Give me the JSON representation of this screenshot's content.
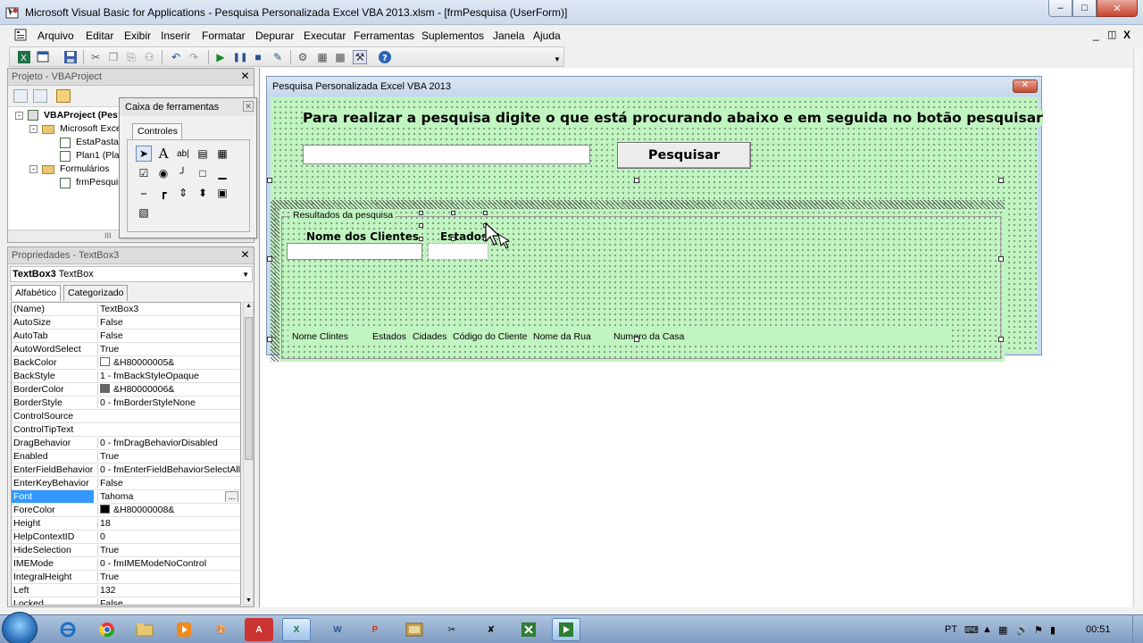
{
  "window": {
    "title": "Microsoft Visual Basic for Applications - Pesquisa Personalizada Excel VBA 2013.xlsm - [frmPesquisa (UserForm)]",
    "min_label": "–",
    "max_label": "□",
    "close_label": "✕"
  },
  "menu": {
    "items": [
      "Arquivo",
      "Editar",
      "Exibir",
      "Inserir",
      "Formatar",
      "Depurar",
      "Executar",
      "Ferramentas",
      "Suplementos",
      "Janela",
      "Ajuda"
    ],
    "controls": [
      "_",
      "&#8862;",
      "X"
    ]
  },
  "project": {
    "title": "Projeto - VBAProject",
    "close": "✕",
    "root": "VBAProject (Pes",
    "excel_folder": "Microsoft Exce",
    "sheet1": "EstaPasta_",
    "sheet2": "Plan1 (Plan",
    "forms_folder": "Formulários",
    "form": "frmPesquis",
    "scroll_label": "III"
  },
  "toolbox": {
    "title": "Caixa de ferramentas",
    "close": "✕",
    "tab": "Controles"
  },
  "properties": {
    "title": "Propriedades - TextBox3",
    "close": "✕",
    "object_name": "TextBox3",
    "object_type": "TextBox",
    "tab_alpha": "Alfabético",
    "tab_cat": "Categorizado",
    "rows": [
      {
        "name": "(Name)",
        "value": "TextBox3"
      },
      {
        "name": "AutoSize",
        "value": "False"
      },
      {
        "name": "AutoTab",
        "value": "False"
      },
      {
        "name": "AutoWordSelect",
        "value": "True"
      },
      {
        "name": "BackColor",
        "value": "&H80000005&"
      },
      {
        "name": "BackStyle",
        "value": "1 - fmBackStyleOpaque"
      },
      {
        "name": "BorderColor",
        "value": "&H80000006&"
      },
      {
        "name": "BorderStyle",
        "value": "0 - fmBorderStyleNone"
      },
      {
        "name": "ControlSource",
        "value": ""
      },
      {
        "name": "ControlTipText",
        "value": ""
      },
      {
        "name": "DragBehavior",
        "value": "0 - fmDragBehaviorDisabled"
      },
      {
        "name": "Enabled",
        "value": "True"
      },
      {
        "name": "EnterFieldBehavior",
        "value": "0 - fmEnterFieldBehaviorSelectAll"
      },
      {
        "name": "EnterKeyBehavior",
        "value": "False"
      },
      {
        "name": "Font",
        "value": "Tahoma"
      },
      {
        "name": "ForeColor",
        "value": "&H80000008&"
      },
      {
        "name": "Height",
        "value": "18"
      },
      {
        "name": "HelpContextID",
        "value": "0"
      },
      {
        "name": "HideSelection",
        "value": "True"
      },
      {
        "name": "IMEMode",
        "value": "0 - fmIMEModeNoControl"
      },
      {
        "name": "IntegralHeight",
        "value": "True"
      },
      {
        "name": "Left",
        "value": "132"
      },
      {
        "name": "Locked",
        "value": "False"
      }
    ],
    "ellipsis": "..."
  },
  "userform": {
    "title": "Pesquisa Personalizada Excel VBA 2013",
    "close": "✕",
    "label_main": "Para realizar a pesquisa digite o que está procurando abaixo e em seguida no botão pesquisar",
    "search_value": "",
    "button": "Pesquisar",
    "frame_caption": "Resultados da pesquisa",
    "col1": "Nome dos Clientes",
    "col2": "Estados",
    "results": [
      "Nome Clintes",
      "Estados",
      "Cidades",
      "Código do Cliente",
      "Nome da Rua",
      "Numero da Casa"
    ]
  },
  "taskbar": {
    "lang": "PT",
    "time": "00:51",
    "apps": [
      "A",
      "X",
      "W",
      "P"
    ]
  },
  "colors": {
    "form_back": "#c0f4c0",
    "selection": "#3399ff"
  }
}
